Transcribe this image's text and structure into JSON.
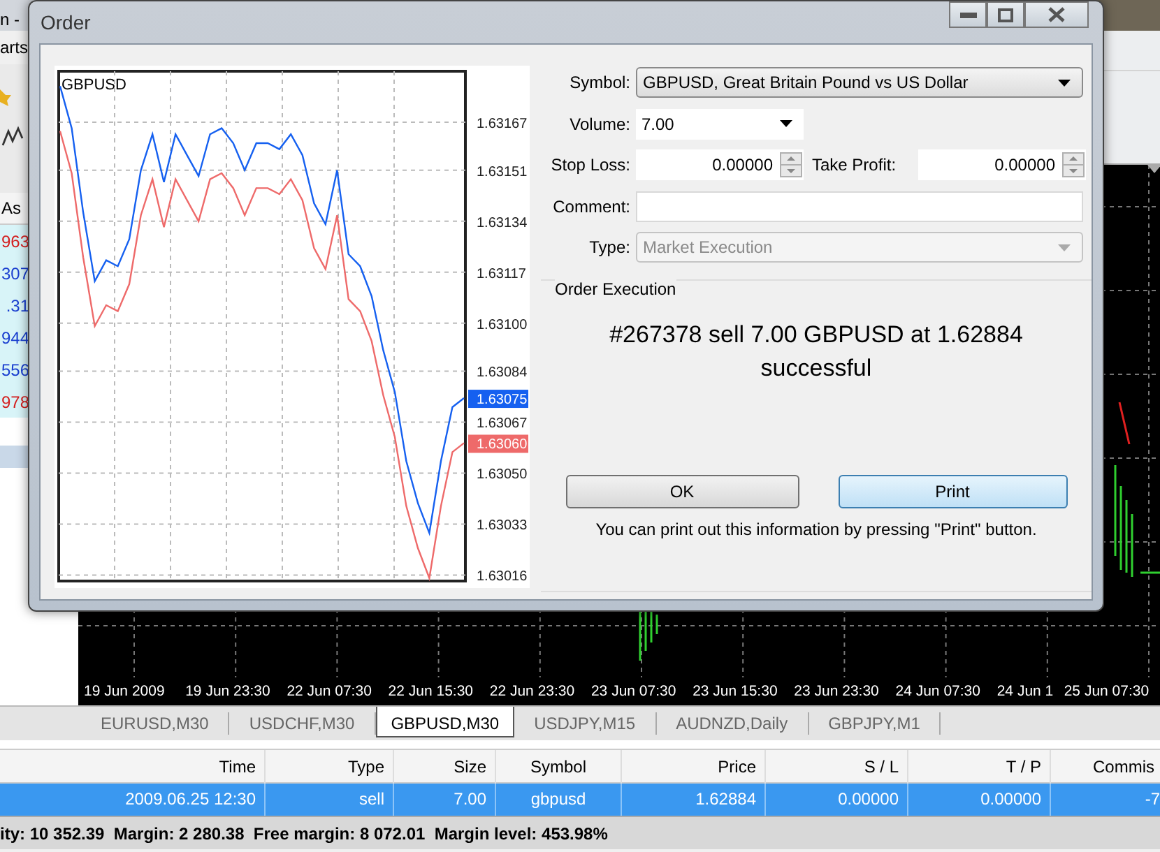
{
  "app": {
    "title_fragment": "n -",
    "menu_fragment": "arts"
  },
  "market_watch": {
    "column": "As",
    "rows": [
      {
        "value": "963",
        "color": "#d42020"
      },
      {
        "value": "307",
        "color": "#1a3fd0"
      },
      {
        "value": ".31",
        "color": "#1a3fd0"
      },
      {
        "value": "944",
        "color": "#1a3fd0"
      },
      {
        "value": "556",
        "color": "#1a3fd0"
      },
      {
        "value": "978",
        "color": "#d42020"
      }
    ]
  },
  "main_chart": {
    "date_labels": [
      "19 Jun 2009",
      "19 Jun 23:30",
      "22 Jun 07:30",
      "22 Jun 15:30",
      "22 Jun 23:30",
      "23 Jun 07:30",
      "23 Jun 15:30",
      "23 Jun 23:30",
      "24 Jun 07:30",
      "24 Jun 1",
      "25 Jun 07:30"
    ]
  },
  "chart_tabs": [
    {
      "label": "EURUSD,M30",
      "selected": false
    },
    {
      "label": "USDCHF,M30",
      "selected": false
    },
    {
      "label": "GBPUSD,M30",
      "selected": true
    },
    {
      "label": "USDJPY,M15",
      "selected": false
    },
    {
      "label": "AUDNZD,Daily",
      "selected": false
    },
    {
      "label": "GBPJPY,M1",
      "selected": false
    }
  ],
  "trade_table": {
    "columns": [
      "Time",
      "Type",
      "Size",
      "Symbol",
      "Price",
      "S / L",
      "T / P",
      "Commis"
    ],
    "rows": [
      {
        "cells": [
          "2009.06.25 12:30",
          "sell",
          "7.00",
          "gbpusd",
          "1.62884",
          "0.00000",
          "0.00000",
          "-7"
        ],
        "selected": true
      }
    ]
  },
  "status_bar": "ity: 10 352.39  Margin: 2 280.38  Free margin: 8 072.01  Margin level: 453.98%",
  "dialog": {
    "title": "Order",
    "chart_data": {
      "type": "line",
      "title": "GBPUSD",
      "grid": true,
      "ylim": [
        1.63014,
        1.63184
      ],
      "yticks": [
        1.63167,
        1.63151,
        1.63134,
        1.63117,
        {
          "value": 1.631,
          "label": "1.63100"
        },
        1.63084,
        1.63067,
        {
          "value": 1.6305,
          "label": "1.63050"
        },
        1.63033,
        1.63016
      ],
      "series": [
        {
          "color": "#1560f0",
          "values": [
            1.63179,
            1.63165,
            1.63137,
            1.63114,
            1.63121,
            1.63119,
            1.63128,
            1.63151,
            1.63163,
            1.63147,
            1.63163,
            1.63156,
            1.63149,
            1.63163,
            1.63165,
            1.6316,
            1.63151,
            1.6316,
            1.6316,
            1.63158,
            1.63163,
            1.63156,
            1.6314,
            1.63133,
            1.63151,
            1.63123,
            1.63119,
            1.63109,
            1.63091,
            1.63077,
            1.63054,
            1.6304,
            1.6303,
            1.63054,
            1.63072,
            1.63075
          ]
        },
        {
          "color": "#ee6a6a",
          "values": [
            1.63164,
            1.6315,
            1.63122,
            1.63099,
            1.63106,
            1.63104,
            1.63113,
            1.63136,
            1.63148,
            1.63132,
            1.63148,
            1.63141,
            1.63134,
            1.63148,
            1.6315,
            1.63145,
            1.63136,
            1.63145,
            1.63145,
            1.63143,
            1.63148,
            1.63141,
            1.63125,
            1.63118,
            1.63136,
            1.63108,
            1.63104,
            1.63094,
            1.63076,
            1.63062,
            1.63039,
            1.63025,
            1.63015,
            1.63039,
            1.63057,
            1.6306
          ]
        }
      ]
    },
    "price_tags": [
      {
        "label": "1.63075",
        "color": "#1560f0"
      },
      {
        "label": "1.63060",
        "color": "#ee6a6a"
      }
    ],
    "symbol": {
      "label": "Symbol:",
      "value": "GBPUSD, Great Britain Pound vs US Dollar"
    },
    "volume": {
      "label": "Volume:",
      "value": "7.00"
    },
    "stop_loss": {
      "label": "Stop Loss:",
      "value": "0.00000"
    },
    "take_profit": {
      "label": "Take Profit:",
      "value": "0.00000"
    },
    "comment": {
      "label": "Comment:"
    },
    "type": {
      "label": "Type:",
      "value": "Market Execution",
      "disabled": true
    },
    "execution": {
      "title": "Order Execution",
      "message": [
        "#267378 sell 7.00 GBPUSD at 1.62884",
        "successful"
      ],
      "buttons": [
        {
          "label": "OK",
          "default": false
        },
        {
          "label": "Print",
          "default": true
        }
      ],
      "note": "You can print out this information by pressing \"Print\" button."
    }
  }
}
